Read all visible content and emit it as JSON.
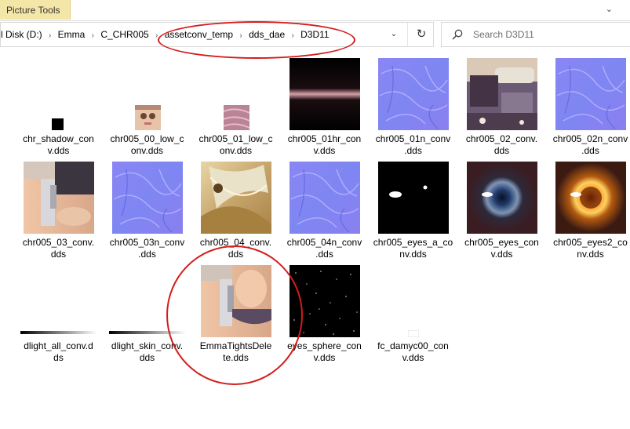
{
  "ribbon": {
    "context_tab": "Picture Tools",
    "collapse_glyph": "⌄"
  },
  "address_bar": {
    "crumbs": [
      "l Disk (D:)",
      "Emma",
      "C_CHR005",
      "assetconv_temp",
      "dds_dae",
      "D3D11"
    ],
    "separator": "›",
    "dropdown_glyph": "⌄",
    "refresh_glyph": "↻"
  },
  "search": {
    "placeholder": "Search D3D11"
  },
  "files": [
    {
      "name": "chr_shadow_conv.dds",
      "line1": "chr_shadow_con",
      "line2": "v.dds",
      "thumb": "shadow"
    },
    {
      "name": "chr005_00_low_conv.dds",
      "line1": "chr005_00_low_c",
      "line2": "onv.dds",
      "thumb": "face-small"
    },
    {
      "name": "chr005_01_low_conv.dds",
      "line1": "chr005_01_low_c",
      "line2": "onv.dds",
      "thumb": "pink-small"
    },
    {
      "name": "chr005_01hr_conv.dds",
      "line1": "chr005_01hr_con",
      "line2": "v.dds",
      "thumb": "hair-strip"
    },
    {
      "name": "chr005_01n_conv.dds",
      "line1": "chr005_01n_conv",
      "line2": ".dds",
      "thumb": "normal"
    },
    {
      "name": "chr005_02_conv.dds",
      "line1": "chr005_02_conv.",
      "line2": "dds",
      "thumb": "clothes"
    },
    {
      "name": "chr005_02n_conv.dds",
      "line1": "chr005_02n_conv",
      "line2": ".dds",
      "thumb": "normal"
    },
    {
      "name": "chr005_03_conv.dds",
      "line1": "chr005_03_conv.",
      "line2": "dds",
      "thumb": "skin"
    },
    {
      "name": "chr005_03n_conv.dds",
      "line1": "chr005_03n_conv",
      "line2": ".dds",
      "thumb": "normal"
    },
    {
      "name": "chr005_04_conv.dds",
      "line1": "chr005_04_conv.",
      "line2": "dds",
      "thumb": "gold"
    },
    {
      "name": "chr005_04n_conv.dds",
      "line1": "chr005_04n_conv",
      "line2": ".dds",
      "thumb": "normal"
    },
    {
      "name": "chr005_eyes_a_conv.dds",
      "line1": "chr005_eyes_a_co",
      "line2": "nv.dds",
      "thumb": "eyes-a"
    },
    {
      "name": "chr005_eyes_conv.dds",
      "line1": "chr005_eyes_con",
      "line2": "v.dds",
      "thumb": "eye-blue"
    },
    {
      "name": "chr005_eyes2_conv.dds",
      "line1": "chr005_eyes2_co",
      "line2": "nv.dds",
      "thumb": "eye-orange"
    },
    {
      "name": "dlight_all_conv.dds",
      "line1": "dlight_all_conv.d",
      "line2": "ds",
      "thumb": "gradient"
    },
    {
      "name": "dlight_skin_conv.dds",
      "line1": "dlight_skin_conv.",
      "line2": "dds",
      "thumb": "gradient"
    },
    {
      "name": "EmmaTightsDelete.dds",
      "line1": "EmmaTightsDele",
      "line2": "te.dds",
      "thumb": "tights"
    },
    {
      "name": "eyes_sphere_conv.dds",
      "line1": "eyes_sphere_con",
      "line2": "v.dds",
      "thumb": "stars"
    },
    {
      "name": "fc_damyc00_conv.dds",
      "line1": "fc_damyc00_con",
      "line2": "v.dds",
      "thumb": "white-small"
    }
  ],
  "colors": {
    "annotation": "#d41c1c",
    "context_tab": "#f4e6a6"
  }
}
